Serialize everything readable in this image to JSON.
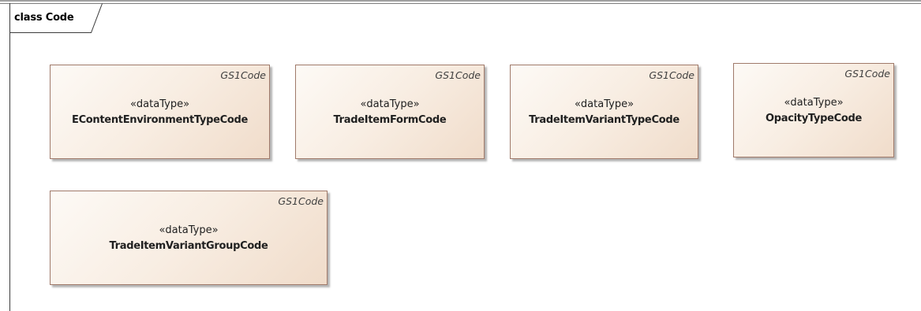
{
  "diagram": {
    "frame_title": "class Code",
    "classes": [
      {
        "tag": "GS1Code",
        "stereotype": "«dataType»",
        "name": "EContentEnvironmentTypeCode"
      },
      {
        "tag": "GS1Code",
        "stereotype": "«dataType»",
        "name": "TradeItemFormCode"
      },
      {
        "tag": "GS1Code",
        "stereotype": "«dataType»",
        "name": "TradeItemVariantTypeCode"
      },
      {
        "tag": "GS1Code",
        "stereotype": "«dataType»",
        "name": "OpacityTypeCode"
      },
      {
        "tag": "GS1Code",
        "stereotype": "«dataType»",
        "name": "TradeItemVariantGroupCode"
      }
    ]
  }
}
